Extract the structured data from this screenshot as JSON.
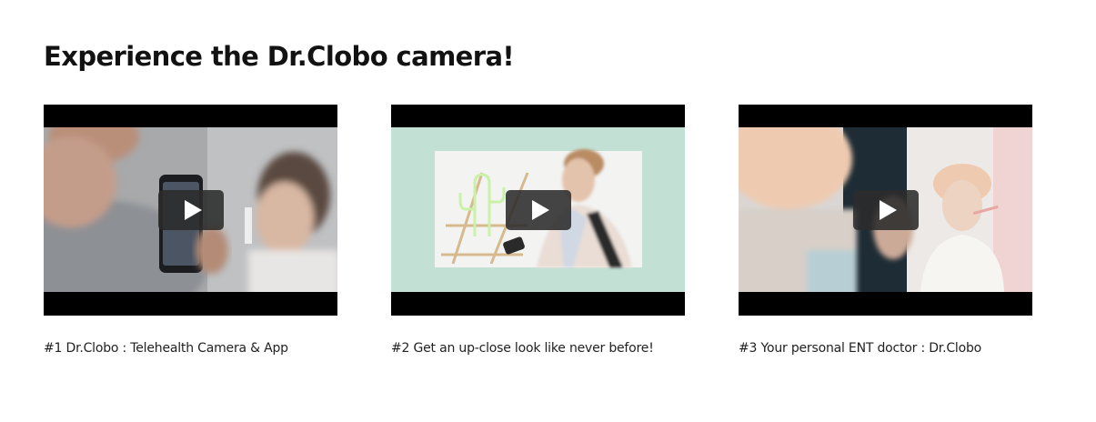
{
  "section": {
    "title": "Experience the Dr.Clobo camera!"
  },
  "videos": [
    {
      "caption": "#1 Dr.Clobo : Telehealth Camera & App",
      "play_icon": "play-icon"
    },
    {
      "caption": "#2 Get an up-close look like never before!",
      "play_icon": "play-icon"
    },
    {
      "caption": "#3 Your personal ENT doctor : Dr.Clobo",
      "play_icon": "play-icon"
    }
  ],
  "colors": {
    "letterbox": "#000000",
    "play_button_bg": "#2b2b2b",
    "mint_background": "#c3e0d4",
    "title_text": "#121212"
  }
}
